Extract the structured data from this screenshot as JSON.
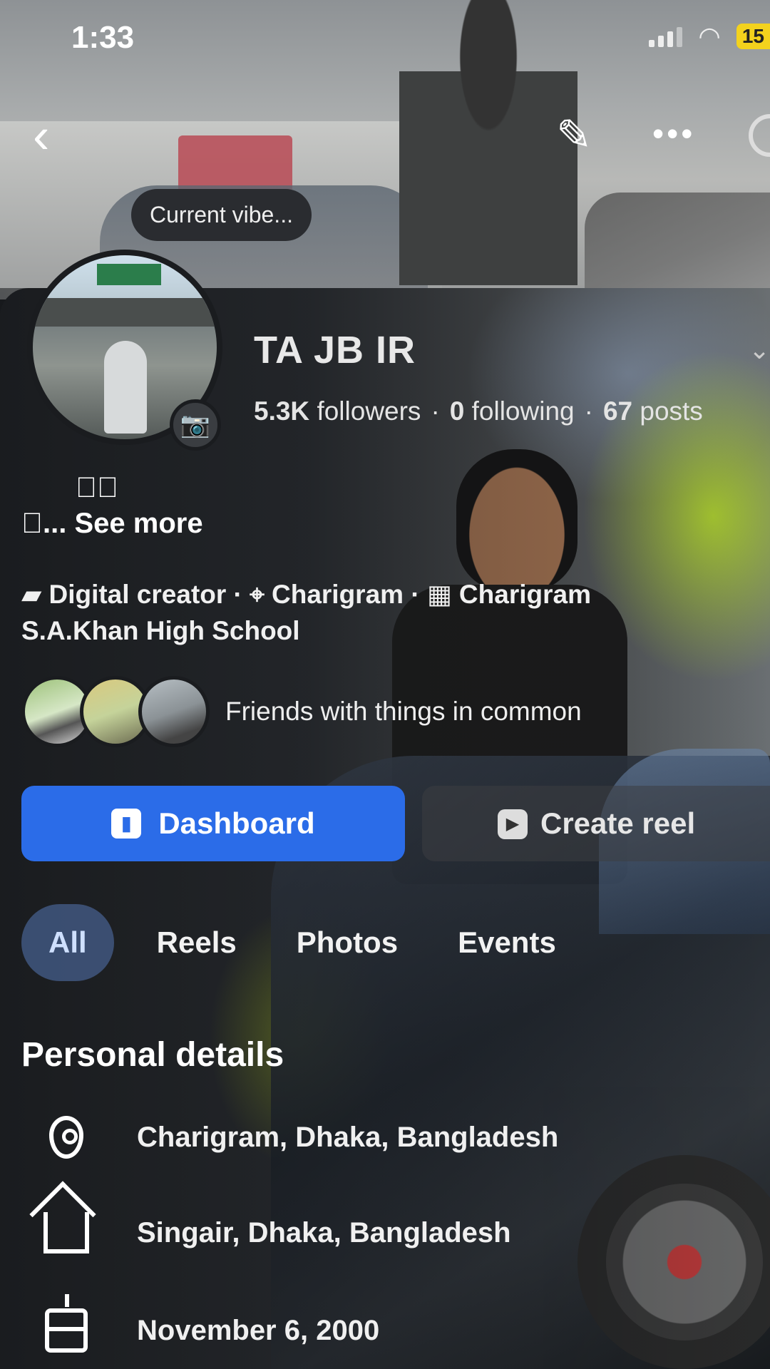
{
  "status_bar": {
    "time": "1:33",
    "battery": "15"
  },
  "cover": {
    "badge_text": "Current vibe..."
  },
  "profile": {
    "name": "TA JB IR",
    "followers_count": "5.3K",
    "followers_label": "followers",
    "following_count": "0",
    "following_label": "following",
    "posts_count": "67",
    "posts_label": "posts",
    "bio_line1": "",
    "bio_line2": "...",
    "see_more": "See more",
    "category": "Digital creator",
    "location": "Charigram",
    "workplace": "Charigram",
    "school": "S.A.Khan High School",
    "friends_text": "Friends with things in common"
  },
  "actions": {
    "dashboard_label": "Dashboard",
    "create_reel_label": "Create reel"
  },
  "tabs": [
    {
      "label": "All",
      "active": true
    },
    {
      "label": "Reels"
    },
    {
      "label": "Photos"
    },
    {
      "label": "Events"
    }
  ],
  "personal_details": {
    "title": "Personal details",
    "items": [
      {
        "icon": "location-pin-icon",
        "text": "Charigram, Dhaka, Bangladesh"
      },
      {
        "icon": "home-icon",
        "text": "Singair, Dhaka, Bangladesh"
      },
      {
        "icon": "birthday-cake-icon",
        "text": "November 6, 2000"
      }
    ]
  },
  "colors": {
    "accent": "#2b6ce8",
    "background": "#1b1d21"
  }
}
